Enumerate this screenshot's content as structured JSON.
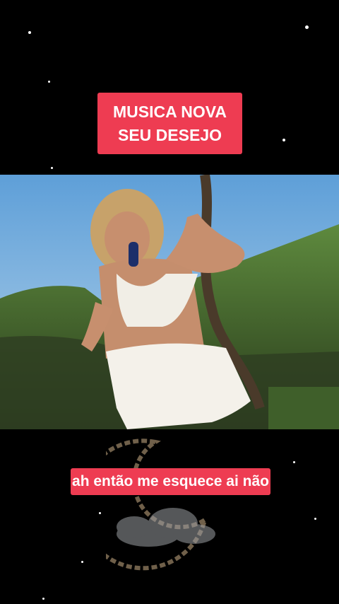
{
  "title": {
    "line1": "MUSICA NOVA",
    "line2": "SEU DESEJO"
  },
  "caption": "ah então me esquece ai não",
  "colors": {
    "accent": "#ee3c52",
    "background": "#000000"
  },
  "video": {
    "icon": "video-frame"
  }
}
